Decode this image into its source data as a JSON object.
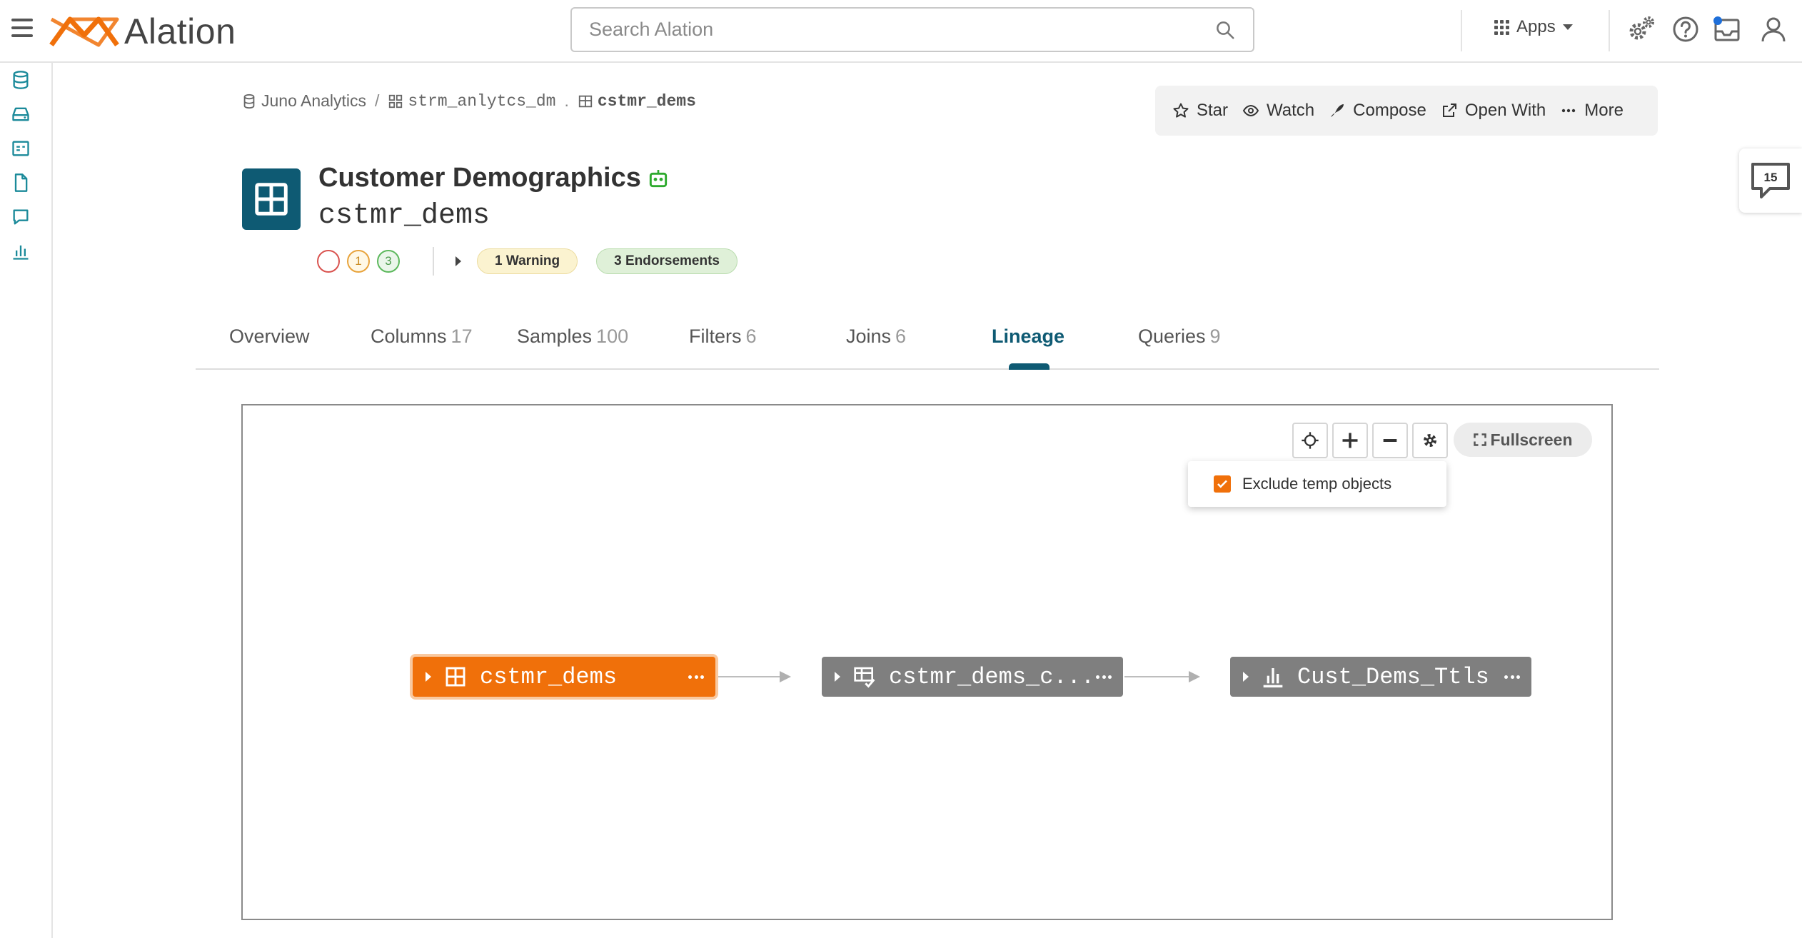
{
  "header": {
    "logo_text": "Alation",
    "search_placeholder": "Search Alation",
    "apps_label": "Apps"
  },
  "breadcrumb": {
    "datasource": "Juno Analytics",
    "separator": "/",
    "schema": "strm_anlytcs_dm",
    "dot": ".",
    "table": "cstmr_dems"
  },
  "actions": {
    "star": "Star",
    "watch": "Watch",
    "compose": "Compose",
    "open_with": "Open With",
    "more": "More"
  },
  "object": {
    "title": "Customer Demographics",
    "name": "cstmr_dems",
    "trust": {
      "deprecations": "",
      "warnings": "1",
      "endorsements": "3"
    },
    "warning_pill": "1 Warning",
    "endorsement_pill": "3 Endorsements"
  },
  "tabs": [
    {
      "label": "Overview",
      "count": ""
    },
    {
      "label": "Columns",
      "count": "17"
    },
    {
      "label": "Samples",
      "count": "100"
    },
    {
      "label": "Filters",
      "count": "6"
    },
    {
      "label": "Joins",
      "count": "6"
    },
    {
      "label": "Lineage",
      "count": ""
    },
    {
      "label": "Queries",
      "count": "9"
    }
  ],
  "lineage": {
    "fullscreen_label": "Fullscreen",
    "exclude_temp_label": "Exclude temp objects",
    "exclude_temp_checked": true,
    "nodes": [
      {
        "label": "cstmr_dems",
        "icon": "table-icon",
        "selected": true
      },
      {
        "label": "cstmr_dems_c...",
        "icon": "query-icon",
        "selected": false
      },
      {
        "label": "Cust_Dems_Ttls",
        "icon": "bi-report-icon",
        "selected": false
      }
    ]
  },
  "conversations": {
    "count": "15"
  },
  "colors": {
    "brand_orange": "#f0700a",
    "brand_teal": "#0e5a73",
    "node_gray": "#7f7f7f",
    "rail_icon": "#1b8a9a"
  }
}
